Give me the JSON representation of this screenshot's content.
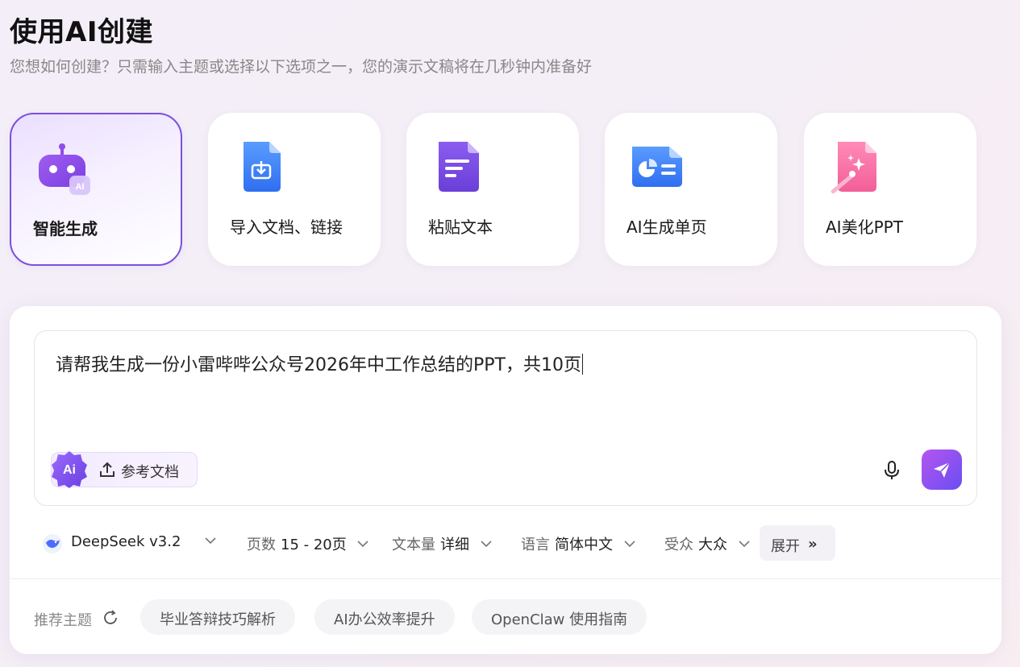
{
  "header": {
    "title": "使用AI创建",
    "subtitle": "您想如何创建？只需输入主题或选择以下选项之一，您的演示文稿将在几秒钟内准备好"
  },
  "modes": [
    {
      "label": "智能生成",
      "icon": "robot-icon",
      "active": true
    },
    {
      "label": "导入文档、链接",
      "icon": "import-document-icon",
      "active": false
    },
    {
      "label": "粘贴文本",
      "icon": "paste-text-icon",
      "active": false
    },
    {
      "label": "AI生成单页",
      "icon": "single-page-chart-icon",
      "active": false
    },
    {
      "label": "AI美化PPT",
      "icon": "beautify-magic-icon",
      "active": false
    }
  ],
  "input": {
    "prompt": "请帮我生成一份小雷哔哔公众号2026年中工作总结的PPT，共10页",
    "ref_badge": "Ai",
    "ref_label": "参考文档"
  },
  "options": {
    "model": "DeepSeek v3.2",
    "pages_label": "页数",
    "pages_value": "15 - 20页",
    "text_label": "文本量",
    "text_value": "详细",
    "lang_label": "语言",
    "lang_value": "简体中文",
    "audience_label": "受众",
    "audience_value": "大众",
    "expand_label": "展开",
    "expand_icon": "»"
  },
  "recommend": {
    "label": "推荐主题",
    "chips": [
      "毕业答辩技巧解析",
      "AI办公效率提升",
      "OpenClaw 使用指南"
    ]
  },
  "colors": {
    "accent": "#7b4fe0",
    "send_start": "#b456f0",
    "send_end": "#6a4df2"
  }
}
